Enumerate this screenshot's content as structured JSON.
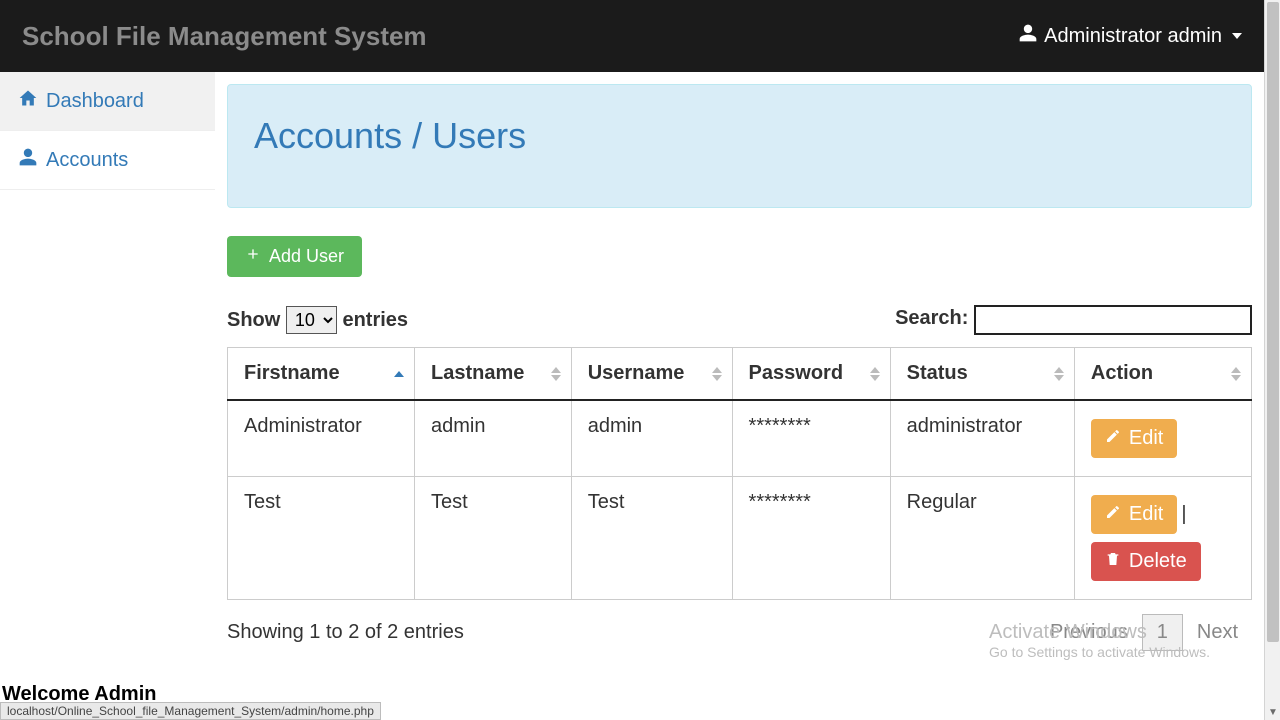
{
  "navbar": {
    "brand": "School File Management System",
    "user_label": "Administrator admin"
  },
  "sidebar": {
    "items": [
      {
        "label": "Dashboard"
      },
      {
        "label": "Accounts"
      }
    ]
  },
  "page": {
    "title": "Accounts / Users",
    "add_user_label": "Add User"
  },
  "datatable": {
    "show_prefix": "Show",
    "show_suffix": "entries",
    "length_value": "10",
    "search_label": "Search:",
    "search_value": "",
    "columns": {
      "firstname": "Firstname",
      "lastname": "Lastname",
      "username": "Username",
      "password": "Password",
      "status": "Status",
      "action": "Action"
    },
    "rows": [
      {
        "firstname": "Administrator",
        "lastname": "admin",
        "username": "admin",
        "password": "********",
        "status": "administrator",
        "edit": "Edit"
      },
      {
        "firstname": "Test",
        "lastname": "Test",
        "username": "Test",
        "password": "********",
        "status": "Regular",
        "edit": "Edit",
        "delete": "Delete"
      }
    ],
    "info": "Showing 1 to 2 of 2 entries",
    "prev": "Previous",
    "page": "1",
    "next": "Next"
  },
  "watermark": {
    "line1": "Activate Windows",
    "line2": "Go to Settings to activate Windows."
  },
  "statusbar": {
    "title": "Welcome Admin",
    "url": "localhost/Online_School_file_Management_System/admin/home.php"
  }
}
